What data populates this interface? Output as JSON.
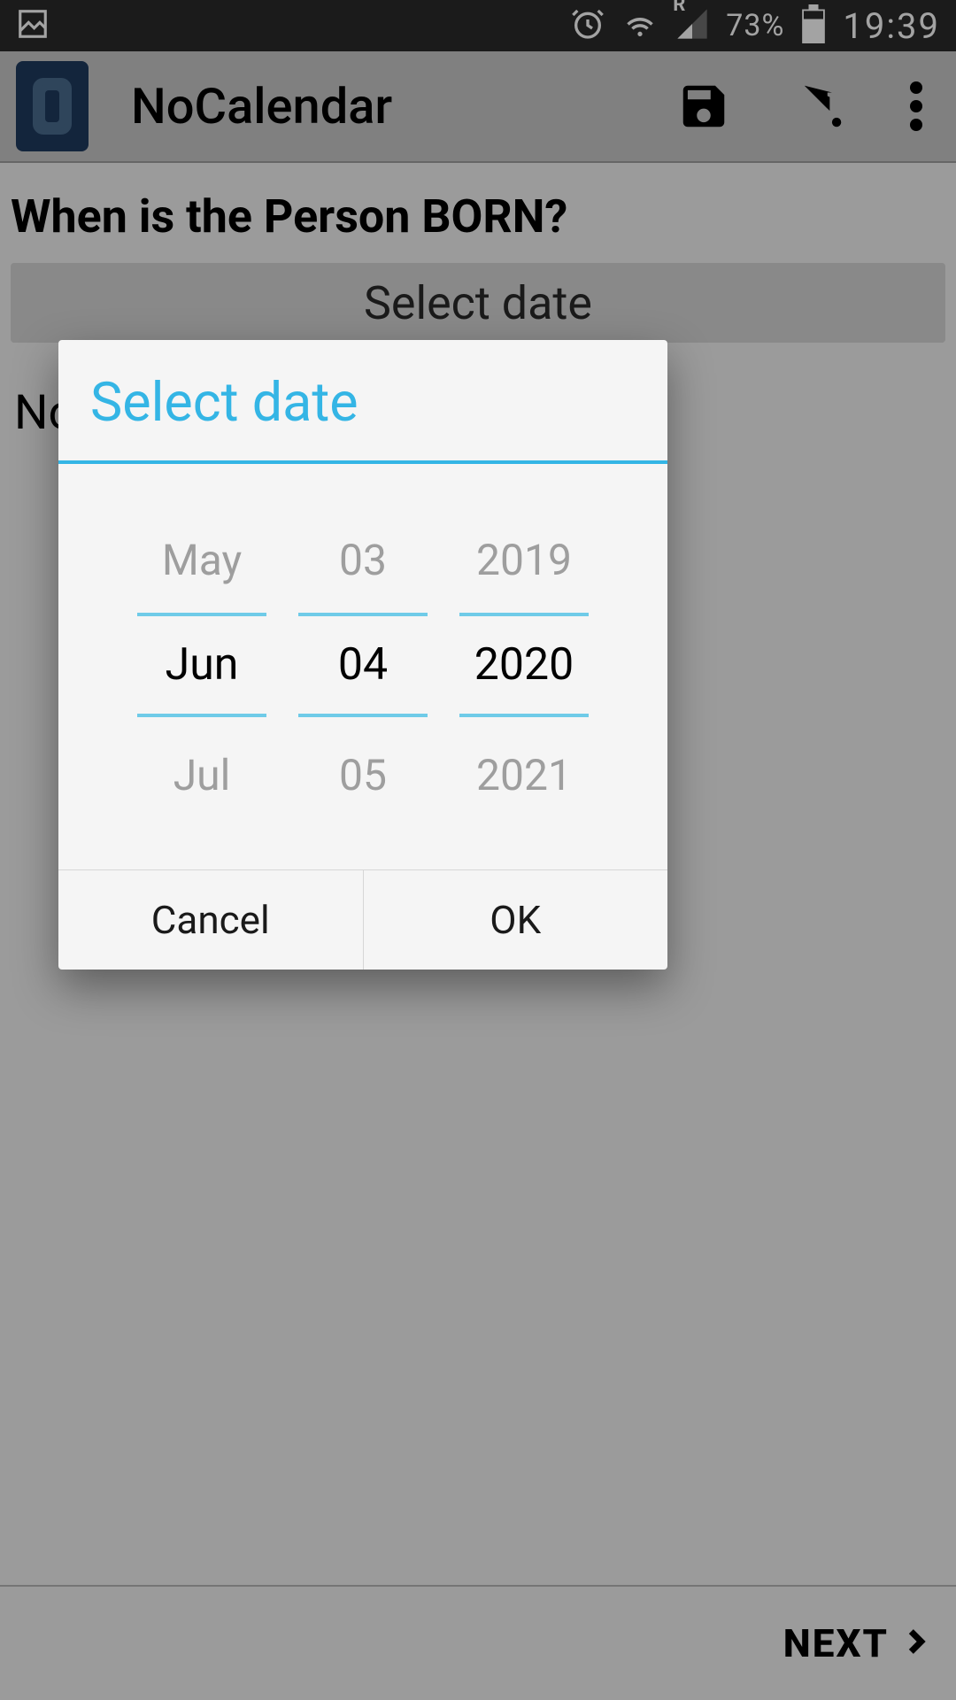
{
  "status": {
    "battery_pct": "73%",
    "time": "19:39",
    "roaming": "R"
  },
  "app": {
    "title": "NoCalendar"
  },
  "main": {
    "question": "When is the Person BORN?",
    "select_button": "Select date",
    "partial_text": "No"
  },
  "footer": {
    "next": "NEXT"
  },
  "dialog": {
    "title": "Select date",
    "month": {
      "prev": "May",
      "curr": "Jun",
      "next": "Jul"
    },
    "day": {
      "prev": "03",
      "curr": "04",
      "next": "05"
    },
    "year": {
      "prev": "2019",
      "curr": "2020",
      "next": "2021"
    },
    "cancel": "Cancel",
    "ok": "OK"
  }
}
